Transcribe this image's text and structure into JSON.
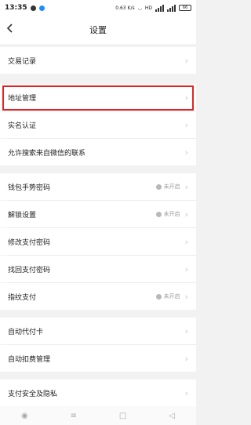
{
  "status_bar": {
    "time": "13:35",
    "network_speed": "0.63 K/s",
    "hd_label": "HD",
    "battery": "66"
  },
  "header": {
    "back_icon": "chevron-left-icon",
    "title": "设置"
  },
  "sections": [
    {
      "items": [
        {
          "label": "交易记录"
        }
      ]
    },
    {
      "items": [
        {
          "label": "地址管理",
          "highlighted": true
        },
        {
          "label": "实名认证"
        },
        {
          "label": "允许搜索来自微信的联系"
        }
      ]
    },
    {
      "items": [
        {
          "label": "钱包手势密码",
          "status": "未开启"
        },
        {
          "label": "解锁设置",
          "status": "未开启"
        },
        {
          "label": "修改支付密码"
        },
        {
          "label": "找回支付密码"
        },
        {
          "label": "指纹支付",
          "status": "未开启"
        }
      ]
    },
    {
      "items": [
        {
          "label": "自动代付卡"
        },
        {
          "label": "自动扣费管理"
        }
      ]
    },
    {
      "items": [
        {
          "label": "支付安全及隐私"
        }
      ]
    }
  ],
  "arrow_glyph": "›",
  "nav_bar": {
    "items": [
      "◉",
      "≡",
      "□",
      "◁"
    ]
  },
  "colors": {
    "highlight": "#e52222",
    "background": "#f2f2f2"
  }
}
